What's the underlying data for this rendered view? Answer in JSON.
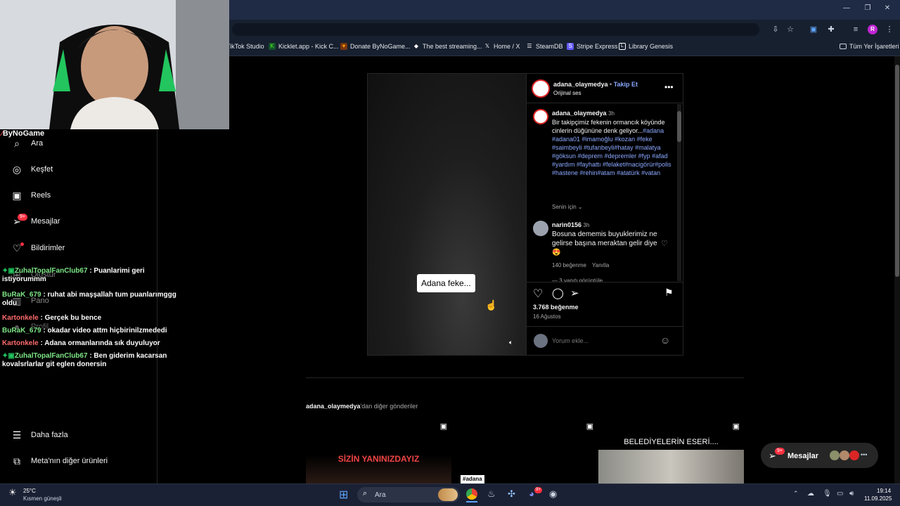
{
  "browser": {
    "bookmarks": [
      {
        "label": "TikTok Studio",
        "icon": "tiktok-icon",
        "color": "#ffffff"
      },
      {
        "label": "Kicklet.app - Kick C...",
        "icon": "kicklet-icon",
        "color": "#53fc18"
      },
      {
        "label": "Donate ByNoGame...",
        "icon": "donate-icon",
        "color": "#f59e0b"
      },
      {
        "label": "The best streaming...",
        "icon": "diamond-icon",
        "color": "#ffffff"
      },
      {
        "label": "Home / X",
        "icon": "x-icon",
        "color": "#ffffff"
      },
      {
        "label": "SteamDB",
        "icon": "steamdb-icon",
        "color": "#ffffff"
      },
      {
        "label": "Stripe Express",
        "icon": "stripe-icon",
        "color": "#635bff"
      },
      {
        "label": "Library Genesis",
        "icon": "library-icon",
        "color": "#ffffff"
      }
    ],
    "all_bookmarks": "Tüm Yer İşaretleri",
    "profile_initial": "R"
  },
  "overlay": {
    "brand": "ByNoGame",
    "chat": [
      {
        "user": "ZuhalTopalFanClub67",
        "text": " : Puanlarimi geri istiyorummm",
        "color": "#7ee787"
      },
      {
        "user": "BuRaK_679",
        "text": " : ruhat abi maşşallah tum puanlarımggg oldu",
        "color": "#7ee787"
      },
      {
        "user": "Kartonkele",
        "text": " : Gerçek bu bence",
        "color": "#ff6b6b"
      },
      {
        "user": "BuRaK_679",
        "text": " : okadar video attm hiçbirinilzmededi",
        "color": "#7ee787"
      },
      {
        "user": "Kartonkele",
        "text": " : Adana ormanlarında sık duyuluyor",
        "color": "#ff6b6b"
      },
      {
        "user": "ZuhalTopalFanClub67",
        "text": " : Ben giderim kacarsan kovalsrlarlar git eglen donersin",
        "color": "#7ee787"
      }
    ]
  },
  "sidebar": {
    "items": [
      {
        "label": "Ara",
        "icon": "search-icon"
      },
      {
        "label": "Keşfet",
        "icon": "compass-icon"
      },
      {
        "label": "Reels",
        "icon": "reels-icon"
      },
      {
        "label": "Mesajlar",
        "icon": "messenger-icon",
        "badge": "9+"
      },
      {
        "label": "Bildirimler",
        "icon": "heart-icon"
      },
      {
        "label": "Oluştur",
        "icon": "plus-icon"
      },
      {
        "label": "Pano",
        "icon": "dashboard-icon"
      },
      {
        "label": "Profil",
        "icon": "profile-icon"
      }
    ],
    "bottom": [
      {
        "label": "Daha fazla",
        "icon": "menu-icon"
      },
      {
        "label": "Meta'nın diğer ürünleri",
        "icon": "grid-icon"
      }
    ]
  },
  "post": {
    "video_caption": "Adana feke...",
    "author": "adana_olaymedya",
    "follow": "Takip Et",
    "audio": "Orijinal ses",
    "caption_author": "adana_olaymedya",
    "caption_time": "3h",
    "caption_text": "Bir takipçimiz fekenin ormancık köyünde cinlerin düğününe denk geliyor...",
    "hashtags": "#adana #adana01 #imamoğlu #kozan #feke #saimbeyli #tufanbeyli#hatay #malatya #göksun #deprem #depremler #fyp #afad #yardım #fayhattı #felaket#nacigörür#polis #hastene #rehin#atam #atatürk #vatan",
    "for_you": "Senin için",
    "comment": {
      "user": "narin0156",
      "time": "3h",
      "text": "Bosuna dememis buyuklerimiz ne gelirse başına meraktan gelir diye 😍",
      "likes": "140 beğenme",
      "reply": "Yanıtla"
    },
    "more_replies": "— 3 yanıtı görüntüle",
    "likes": "3.768 beğenme",
    "date": "16 Ağustos",
    "comment_placeholder": "Yorum ekle..."
  },
  "more_posts": {
    "author": "adana_olaymedya",
    "suffix": "'dan diğer gönderiler",
    "thumbs": [
      {
        "text": "SİZİN YANINIZDAYIZ",
        "tag": ""
      },
      {
        "text": "",
        "tag": "#adana"
      },
      {
        "text": "BELEDİYELERİN ESERİ....",
        "tag": ""
      }
    ]
  },
  "messages_pill": {
    "label": "Mesajlar",
    "badge": "9+"
  },
  "taskbar": {
    "weather_temp": "25°C",
    "weather_desc": "Kısmen güneşli",
    "search": "Ara",
    "time": "19:14",
    "date": "11.09.2025",
    "badge": "9+"
  },
  "colors": {
    "accent": "#0095f6",
    "badge": "#ff3040",
    "link": "#8aa7ff"
  }
}
